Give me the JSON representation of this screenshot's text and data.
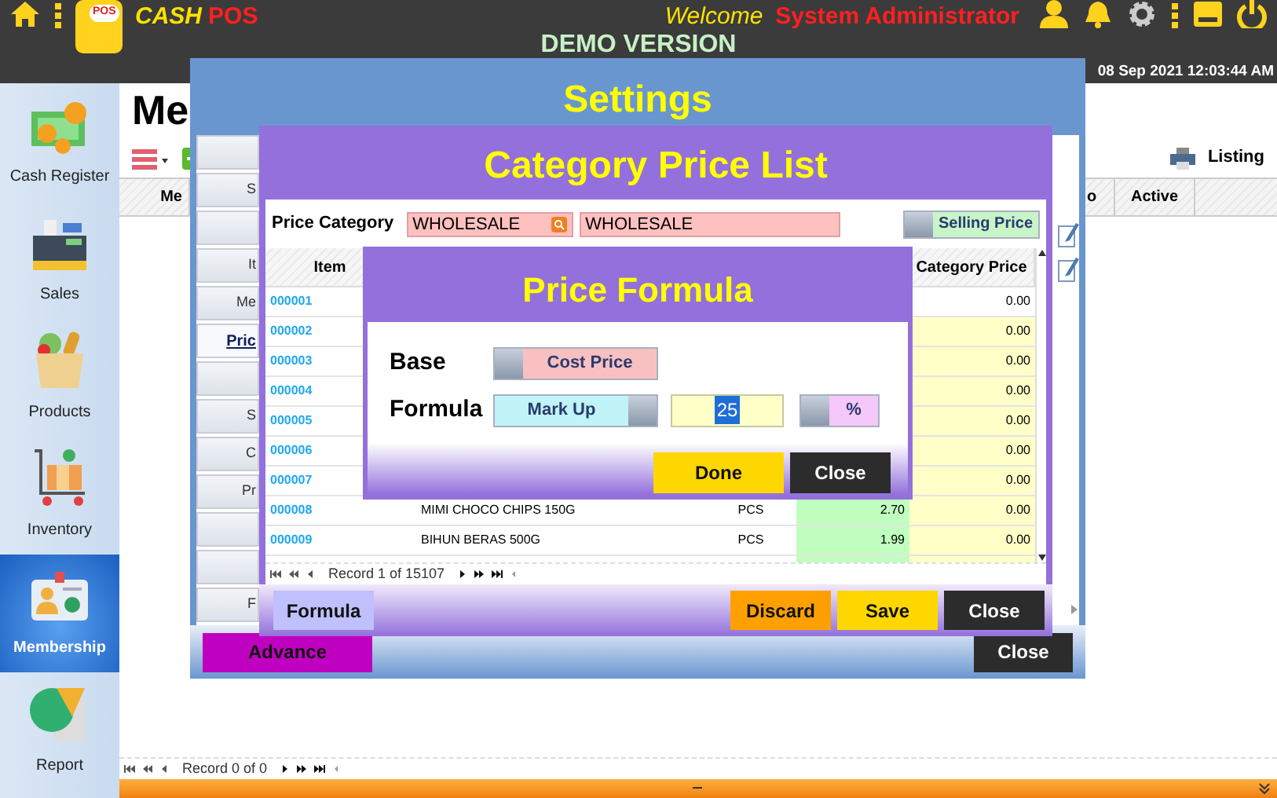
{
  "app_bar": {
    "logo_text": "POS",
    "brand_first": "CASH",
    "brand_second": "POS",
    "welcome": "Welcome",
    "user": "System Administrator",
    "banner": "DEMO VERSION",
    "datetime": "08 Sep 2021 12:03:44 AM"
  },
  "sidebar": {
    "items": [
      {
        "label": "Cash Register",
        "kind": "money",
        "selected": false
      },
      {
        "label": "Sales",
        "kind": "register",
        "selected": false
      },
      {
        "label": "Products",
        "kind": "groceries",
        "selected": false
      },
      {
        "label": "Inventory",
        "kind": "cart",
        "selected": false
      },
      {
        "label": "Membership",
        "kind": "card",
        "selected": true
      },
      {
        "label": "Report",
        "kind": "report",
        "selected": false
      }
    ]
  },
  "page": {
    "title": "Me",
    "listing": "Listing",
    "columns": [
      "Me",
      "o",
      "Active"
    ],
    "pager": "Record 0 of 0"
  },
  "settings": {
    "title": "Settings",
    "tabs": [
      {
        "selected": false
      },
      {
        "label": "S",
        "selected": false
      },
      {
        "selected": false
      },
      {
        "label": "It",
        "selected": false
      },
      {
        "label": "Me",
        "selected": false
      },
      {
        "label": "Pric",
        "selected": true
      },
      {
        "selected": false
      },
      {
        "label": "S",
        "selected": false
      },
      {
        "label": "C",
        "selected": false
      },
      {
        "label": "Pr",
        "selected": false
      },
      {
        "selected": false
      },
      {
        "selected": false
      },
      {
        "label": "F",
        "selected": false
      }
    ],
    "advance": "Advance",
    "close": "Close"
  },
  "category_window": {
    "title": "Category Price List",
    "price_category_label": "Price Category",
    "category_code": "WHOLESALE",
    "category_name": "WHOLESALE",
    "price_toggle": {
      "label": "Selling Price",
      "on": false
    },
    "columns": {
      "item": "Item",
      "category_price": "Category Price"
    },
    "rows": [
      {
        "item": "000001",
        "category_price": "0.00",
        "selected": true
      },
      {
        "item": "000002",
        "category_price": "0.00",
        "selected": false
      },
      {
        "item": "000003",
        "category_price": "0.00",
        "selected": false
      },
      {
        "item": "000004",
        "category_price": "0.00",
        "selected": false
      },
      {
        "item": "000005",
        "category_price": "0.00",
        "selected": false
      },
      {
        "item": "000006",
        "category_price": "0.00",
        "selected": false
      },
      {
        "item": "000007",
        "category_price": "0.00",
        "selected": false
      },
      {
        "item": "000008",
        "description": "MIMI CHOCO CHIPS 150G",
        "uom": "PCS",
        "price": "2.70",
        "category_price": "0.00",
        "selected": false
      },
      {
        "item": "000009",
        "description": "BIHUN BERAS 500G",
        "uom": "PCS",
        "price": "1.99",
        "category_price": "0.00",
        "selected": false
      }
    ],
    "pager": "Record 1 of 15107",
    "buttons": [
      {
        "label": "Formula",
        "kind": "formula"
      },
      {
        "label": "Discard",
        "kind": "discard"
      },
      {
        "label": "Save",
        "kind": "save"
      },
      {
        "label": "Close",
        "kind": "close"
      }
    ]
  },
  "price_formula": {
    "title": "Price Formula",
    "base_label": "Base",
    "base": {
      "label": "Cost Price",
      "on": false
    },
    "formula_label": "Formula",
    "formula": {
      "label": "Mark Up",
      "on": true
    },
    "value": "25",
    "unit": {
      "label": "%",
      "on": false
    },
    "buttons": [
      {
        "label": "Done",
        "kind": "done"
      },
      {
        "label": "Close",
        "kind": "close"
      }
    ]
  }
}
